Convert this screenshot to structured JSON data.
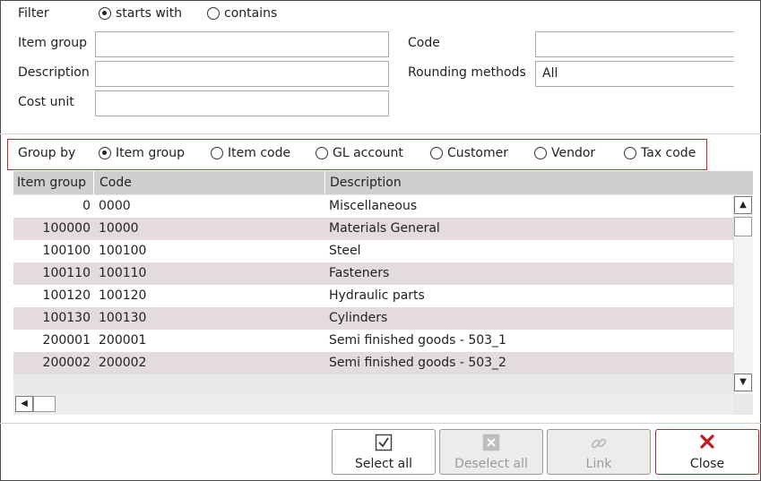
{
  "filter": {
    "label": "Filter",
    "options": [
      {
        "label": "starts with",
        "selected": true
      },
      {
        "label": "contains",
        "selected": false
      }
    ]
  },
  "fields": {
    "item_group": {
      "label": "Item group",
      "value": ""
    },
    "description": {
      "label": "Description",
      "value": ""
    },
    "cost_unit": {
      "label": "Cost unit",
      "value": ""
    },
    "code": {
      "label": "Code",
      "value": ""
    },
    "rounding": {
      "label": "Rounding methods",
      "value": "All"
    }
  },
  "group_by": {
    "label": "Group by",
    "options": [
      {
        "label": "Item group",
        "selected": true
      },
      {
        "label": "Item code",
        "selected": false
      },
      {
        "label": "GL account",
        "selected": false
      },
      {
        "label": "Customer",
        "selected": false
      },
      {
        "label": "Vendor",
        "selected": false
      },
      {
        "label": "Tax code",
        "selected": false
      }
    ]
  },
  "table": {
    "headers": [
      "Item group",
      "Code",
      "Description"
    ],
    "rows": [
      [
        "0",
        "0000",
        "Miscellaneous"
      ],
      [
        "100000",
        "10000",
        "Materials General"
      ],
      [
        "100100",
        "100100",
        "Steel"
      ],
      [
        "100110",
        "100110",
        "Fasteners"
      ],
      [
        "100120",
        "100120",
        "Hydraulic parts"
      ],
      [
        "100130",
        "100130",
        "Cylinders"
      ],
      [
        "200001",
        "200001",
        "Semi finished goods - 503_1"
      ],
      [
        "200002",
        "200002",
        "Semi finished goods - 503_2"
      ]
    ]
  },
  "buttons": {
    "select_all": "Select all",
    "deselect_all": "Deselect all",
    "link": "Link",
    "close": "Close"
  },
  "icons": {
    "select_all": "checkbox-checked-icon",
    "deselect_all": "checkbox-cross-icon",
    "link": "chain-link-icon",
    "close": "red-x-icon"
  },
  "colors": {
    "highlight_border": "#d0212a",
    "row_alt": "#e4dcdc",
    "header_bg": "#cfcfcf"
  }
}
